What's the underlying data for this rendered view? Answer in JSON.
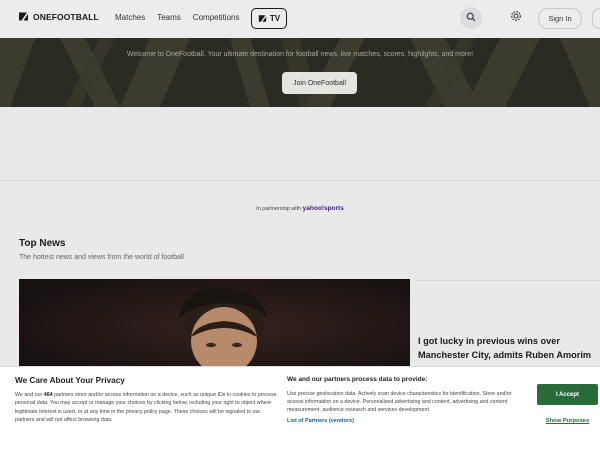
{
  "header": {
    "logo_text": "ONEFOOTBALL",
    "nav": [
      "Matches",
      "Teams",
      "Competitions"
    ],
    "tv_label": "TV",
    "signin_label": "Sign In"
  },
  "hero": {
    "tagline": "Welcome to OneFootball. Your ultimate destination for football news, live matches, scores, highlights, and more!",
    "join_label": "Join OneFootball"
  },
  "partnership": {
    "prefix": "In partnership with",
    "brand": "yahoo!sports"
  },
  "top_news": {
    "title": "Top News",
    "subtitle": "The hottest news and views from the world of football",
    "headline": "I got lucky in previous wins over Manchester City, admits Ruben Amorim"
  },
  "consent": {
    "title": "We Care About Your Privacy",
    "body_start": "We and our ",
    "partner_count": "464",
    "body_rest": " partners store and/or access information on a device, such as unique IDs in cookies to process personal data. You may accept or manage your choices by clicking below, including your right to object where legitimate interest is used, or at any time in the privacy policy page. These choices will be signaled to our partners and will not affect browsing data.",
    "mid_title": "We and our partners process data to provide:",
    "mid_body": "Use precise geolocation data. Actively scan device characteristics for identification. Store and/or access information on a device. Personalised advertising and content, advertising and content measurement, audience research and services development.",
    "partners_link": "List of Partners (vendors)",
    "accept_label": "I Accept",
    "show_purposes_label": "Show Purposes"
  },
  "icons": {
    "logo": "onefootball-logo-icon",
    "tv": "onefootball-tv-icon",
    "search": "search-icon",
    "settings": "gear-icon"
  },
  "colors": {
    "accept": "#2a6b3c",
    "link": "#1b5aa6",
    "hero_bg": "#2a2b23"
  }
}
